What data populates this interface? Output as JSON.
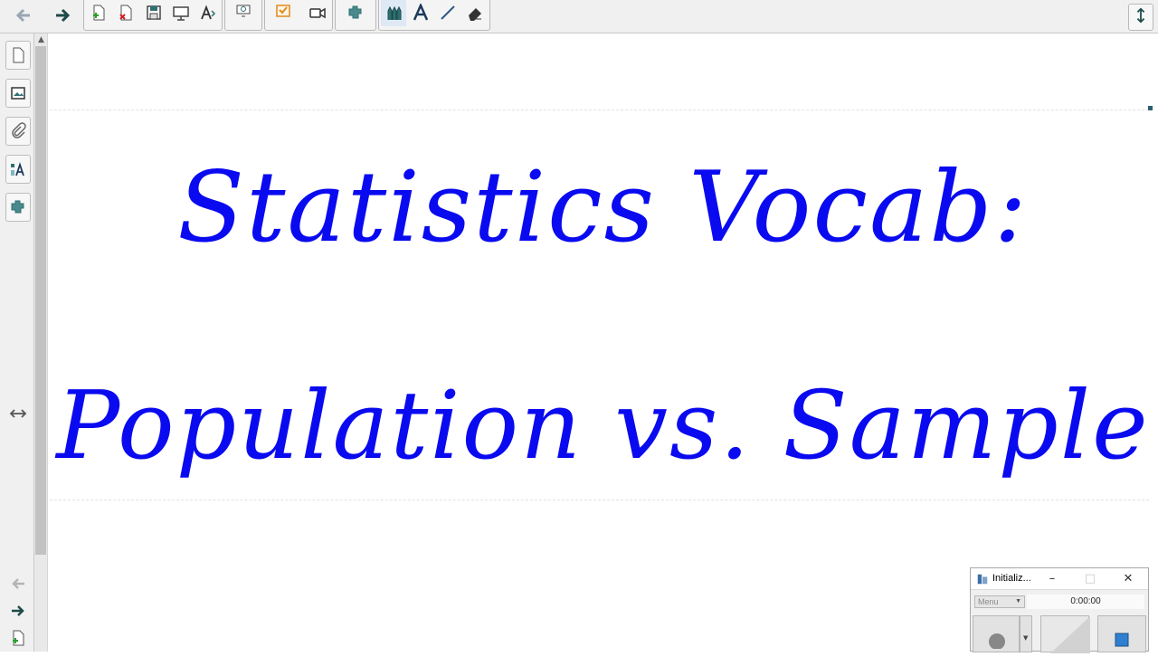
{
  "slide": {
    "line1": "Statistics Vocab:",
    "line2": "Population vs. Sample"
  },
  "recorder": {
    "title": "Initializ...",
    "menu_label": "Menu",
    "time": "0:00:00"
  },
  "colors": {
    "title_text": "#0a0af0",
    "toolbar_bg": "#f0f0f0",
    "accent_icon": "#2f6f72"
  },
  "icons": {
    "toolbar": [
      "back-arrow-icon",
      "forward-arrow-icon",
      "new-page-icon",
      "delete-page-icon",
      "save-icon",
      "screen-shade-icon",
      "text-recognition-icon",
      "screen-capture-icon",
      "checklist-icon",
      "video-icon",
      "add-on-icon",
      "pens-icon",
      "text-icon",
      "line-icon",
      "eraser-icon"
    ],
    "sidebar": [
      "page-sorter-icon",
      "gallery-icon",
      "attachments-icon",
      "properties-icon",
      "add-ons-icon"
    ]
  }
}
